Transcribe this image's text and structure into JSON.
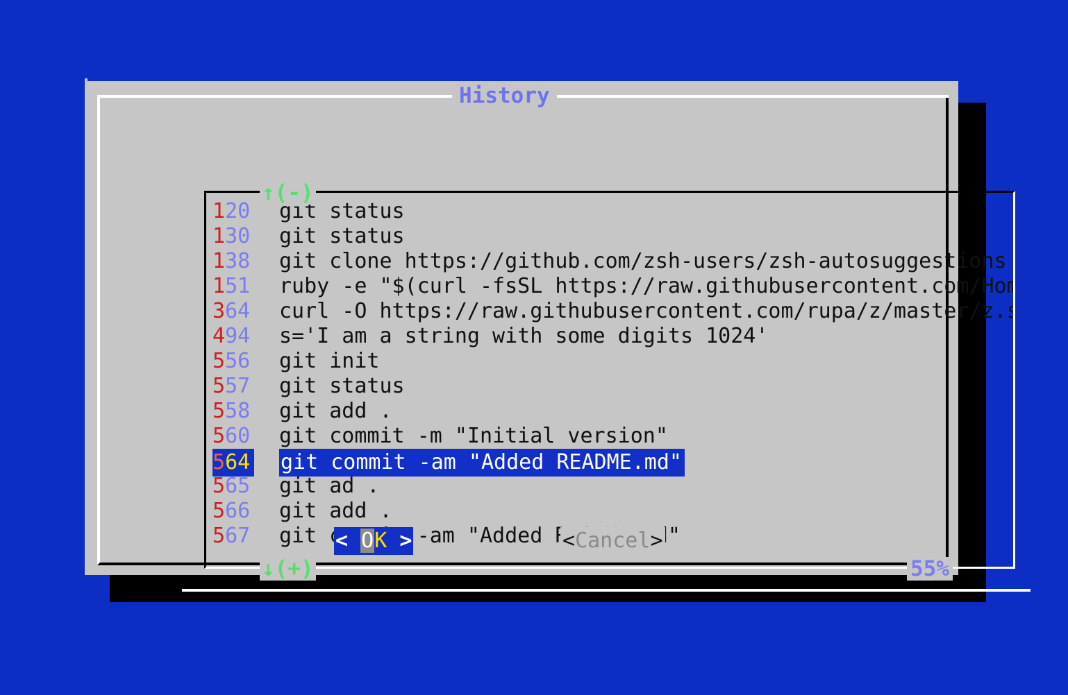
{
  "window": {
    "title": "History",
    "background_color": "#0d2ec4",
    "dialog_color": "#c6c6c6"
  },
  "colors": {
    "accent_blue": "#7b7def",
    "selection_blue": "#122fc8",
    "marker_green": "#55e070",
    "number_red": "#cc2020",
    "accel_yellow": "#ffe000",
    "cancel_gray": "#8a8a8a"
  },
  "listbox": {
    "scroll_up_marker": "↑(-)",
    "scroll_down_marker": "↓(+)",
    "scroll_percent": "55%",
    "selected_index": 10,
    "rows": [
      {
        "num_first": "1",
        "num_rest": "20",
        "command": "git status"
      },
      {
        "num_first": "1",
        "num_rest": "30",
        "command": "git status"
      },
      {
        "num_first": "1",
        "num_rest": "38",
        "command": "git clone https://github.com/zsh-users/zsh-autosuggestions"
      },
      {
        "num_first": "1",
        "num_rest": "51",
        "command": "ruby -e \"$(curl -fsSL https://raw.githubusercontent.com/Homebrew/install/master/install)\""
      },
      {
        "num_first": "3",
        "num_rest": "64",
        "command": "curl -O https://raw.githubusercontent.com/rupa/z/master/z.sh"
      },
      {
        "num_first": "4",
        "num_rest": "94",
        "command": "s='I am a string with some digits 1024'"
      },
      {
        "num_first": "5",
        "num_rest": "56",
        "command": "git init"
      },
      {
        "num_first": "5",
        "num_rest": "57",
        "command": "git status"
      },
      {
        "num_first": "5",
        "num_rest": "58",
        "command": "git add ."
      },
      {
        "num_first": "5",
        "num_rest": "60",
        "command": "git commit -m \"Initial version\""
      },
      {
        "num_first": "5",
        "num_rest": "64",
        "command": "git commit -am \"Added README.md\""
      },
      {
        "num_first": "5",
        "num_rest": "65",
        "command": "git ad ."
      },
      {
        "num_first": "5",
        "num_rest": "66",
        "command": "git add ."
      },
      {
        "num_first": "5",
        "num_rest": "67",
        "command": "git commit -am \"Added README.md\""
      }
    ]
  },
  "buttons": {
    "ok": {
      "left_bracket": "<",
      "gap_left": "  ",
      "accel_char": "O",
      "label_rest": "K",
      "gap_right": "   ",
      "right_bracket": ">"
    },
    "cancel": {
      "left_bracket": "<",
      "label": "Cancel",
      "right_bracket": ">"
    }
  }
}
